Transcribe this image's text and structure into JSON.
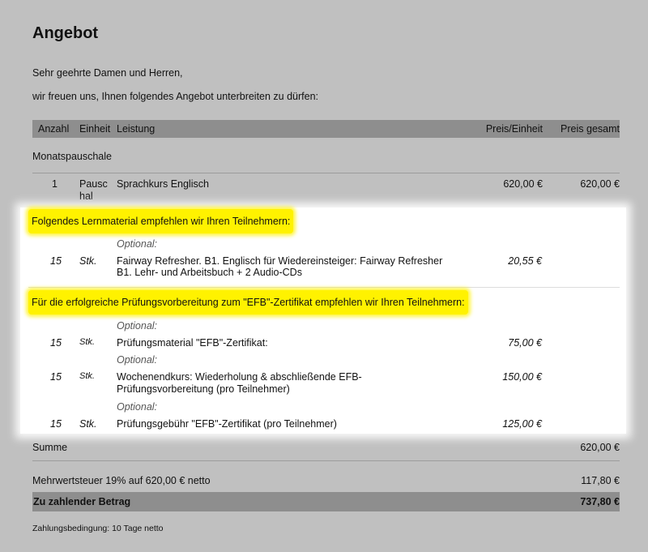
{
  "document": {
    "title": "Angebot",
    "salutation": "Sehr geehrte Damen und Herren,",
    "intro": "wir freuen uns, Ihnen folgendes Angebot unterbreiten zu dürfen:"
  },
  "table": {
    "headers": {
      "anzahl": "Anzahl",
      "einheit": "Einheit",
      "leistung": "Leistung",
      "preis_einheit": "Preis/Einheit",
      "preis_gesamt": "Preis gesamt"
    },
    "group_label": "Monatspauschale",
    "main_row": {
      "qty": "1",
      "unit_line1": "Pausc",
      "unit_line2": "hal",
      "description": "Sprachkurs Englisch",
      "unit_price": "620,00 €",
      "total": "620,00 €"
    }
  },
  "recommendations": {
    "heading1": "Folgendes Lernmaterial empfehlen wir Ihren Teilnehmern:",
    "item1": {
      "optional": "Optional:",
      "qty": "15",
      "unit": "Stk.",
      "desc_line1": "Fairway Refresher. B1. Englisch für Wiedereinsteiger: Fairway Refresher",
      "desc_line2": "B1. Lehr- und Arbeitsbuch + 2 Audio-CDs",
      "price": "20,55 €"
    },
    "heading2": "Für die erfolgreiche Prüfungsvorbereitung zum \"EFB\"-Zertifikat empfehlen wir Ihren Teilnehmern:",
    "item2": {
      "optional": "Optional:",
      "qty": "15",
      "unit": "Stk.",
      "desc": "Prüfungsmaterial \"EFB\"-Zertifikat:",
      "price": "75,00 €"
    },
    "item3": {
      "optional": "Optional:",
      "qty": "15",
      "unit": "Stk.",
      "desc_line1": "Wochenendkurs: Wiederholung & abschließende EFB-",
      "desc_line2": "Prüfungsvorbereitung (pro Teilnehmer)",
      "price": "150,00 €"
    },
    "item4": {
      "optional": "Optional:",
      "qty": "15",
      "unit": "Stk.",
      "desc": "Prüfungsgebühr \"EFB\"-Zertifikat (pro Teilnehmer)",
      "price": "125,00 €"
    }
  },
  "totals": {
    "sum_label": "Summe",
    "sum_value": "620,00 €",
    "vat_label": "Mehrwertsteuer 19% auf 620,00 € netto",
    "vat_value": "117,80 €",
    "due_label": "Zu zahlender Betrag",
    "due_value": "737,80 €"
  },
  "footer": {
    "payment_terms": "Zahlungsbedingung: 10 Tage netto"
  }
}
